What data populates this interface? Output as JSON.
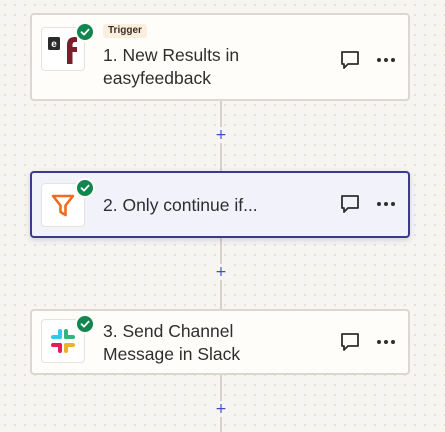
{
  "steps": [
    {
      "badge": "Trigger",
      "title": "1. New Results in\neasyfeedback",
      "app_icon": "easyfeedback-logo-icon",
      "status": "complete",
      "selected": false
    },
    {
      "title": "2. Only continue if...",
      "app_icon": "filter-funnel-icon",
      "status": "complete",
      "selected": true
    },
    {
      "title": "3. Send Channel\nMessage in Slack",
      "app_icon": "slack-logo-icon",
      "status": "complete",
      "selected": false
    }
  ],
  "connectors": [
    {
      "label": "+"
    },
    {
      "label": "+"
    },
    {
      "label": "+"
    }
  ],
  "colors": {
    "status_check": "#12864f",
    "selected_border": "#3b3a8f",
    "plus": "#3d4ad1",
    "easyfeedback_brand": "#7a1e2c",
    "filter_brand": "#f26b21"
  }
}
